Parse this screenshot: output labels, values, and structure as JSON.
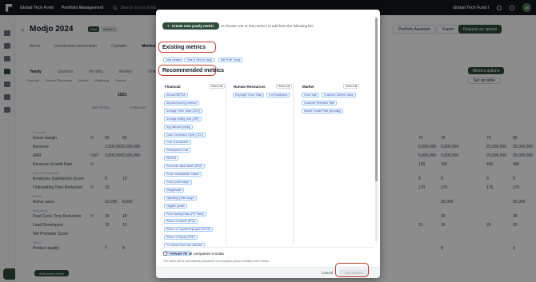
{
  "topbar": {
    "org": "Global Tech Fund",
    "section": "Portfolio Management",
    "search_placeholder": "Search across Edda",
    "fund_selector": "Global Tech Fund I",
    "avatar": "JE"
  },
  "page": {
    "title": "Modjo 2024",
    "status": "Paid",
    "tag": "Series A",
    "tabs": [
      "About",
      "Investments information",
      "Captable",
      "Metrics"
    ],
    "active_tab": "Metrics",
    "buttons": {
      "assistant": "Portfolio Assistant",
      "export": "Export",
      "request": "Request an update"
    },
    "periods": [
      "Yearly",
      "Quarters",
      "Monthly",
      "Weekly",
      "One-off"
    ],
    "active_period": "Yearly",
    "filters": [
      "Financial",
      "Human Resources",
      "Market",
      "Marketing",
      "Product"
    ],
    "metrics_actions": "Metrics actions",
    "set_up_table": "Set up table",
    "col_reported": "REPORTED",
    "col_forecast": "FORECAST",
    "year": "2025",
    "add_yearly_metric": "Add yearly metric",
    "rows": [
      {
        "label": "Financial",
        "section": true
      },
      {
        "label": "Gross margin",
        "unit": "%",
        "v1": "60",
        "v2": "60",
        "v3": "",
        "r1": "74",
        "r2": "75",
        "r3": "79",
        "r4": "80"
      },
      {
        "label": "Revenue",
        "unit": "",
        "v1": "2,500,000",
        "v2": "2,500,000",
        "v3": "",
        "r1": "5,000,000",
        "r2": "5,000,000",
        "r3": "25,000,000",
        "r4": "25,000,000"
      },
      {
        "label": "ARR",
        "unit": "GBP",
        "v1": "2,500,000",
        "v2": "2,500,000",
        "v3": "",
        "r1": "5,000,000",
        "r2": "5,000,000",
        "r3": "25,000,000",
        "r4": "25,000,000"
      },
      {
        "label": "Revenue Growth Rate",
        "unit": "%",
        "v1": "",
        "v2": "",
        "v3": "",
        "r1": "100",
        "r2": "100",
        "r3": "400",
        "r4": "400"
      },
      {
        "label": "Human Resources",
        "section": true
      },
      {
        "label": "Employee Satisfaction Score",
        "unit": "",
        "v1": "8",
        "v2": "10",
        "v3": "",
        "r1": "8",
        "r2": "8",
        "r3": "9",
        "r4": "9"
      },
      {
        "label": "Onboarding Time Reduction",
        "unit": "%",
        "v1": "15",
        "v2": "",
        "v3": "",
        "r1": "170",
        "r2": "175",
        "r3": "175",
        "r4": "175"
      },
      {
        "label": "Market",
        "section": true
      },
      {
        "label": "Active users",
        "unit": "",
        "v1": "10,200",
        "v2": "8,000",
        "v3": "",
        "r1": "",
        "r2": "25,000",
        "r3": "",
        "r4": "50,000"
      },
      {
        "label": "Marketing",
        "section": true
      },
      {
        "label": "Deal Cycle Time Reduction",
        "unit": "%",
        "v1": "15",
        "v2": "18",
        "v3": "",
        "r1": "",
        "r2": "20",
        "r3": "",
        "r4": "25"
      },
      {
        "label": "Lead Developers",
        "unit": "",
        "v1": "10",
        "v2": "10",
        "v3": "",
        "r1": "15",
        "r2": "16",
        "r3": "20",
        "r4": "20"
      },
      {
        "label": "Net Promoter Score",
        "unit": "",
        "v1": "",
        "v2": "",
        "v3": "",
        "r1": "",
        "r2": "",
        "r3": "",
        "r4": ""
      },
      {
        "label": "Other",
        "section": true
      },
      {
        "label": "Product quality",
        "unit": "",
        "v1": "7",
        "v2": "8",
        "v3": "",
        "r1": "",
        "r2": "8",
        "r3": "",
        "r4": "9"
      }
    ]
  },
  "modal": {
    "create_button": "Create new yearly metric",
    "or_choose": "or choose one or few metrics to add from the following list:",
    "existing_title": "Existing metrics",
    "existing": [
      "Jobs created",
      "Time to Hire (in days)",
      "Net Profit Yearly"
    ],
    "recommended_title": "Recommended metrics",
    "select_all": "Select all",
    "columns": {
      "financial": {
        "title": "Financial",
        "items": [
          "Annual EBITDA",
          "Annual recurring revenue",
          "Average Order Value (AOV)",
          "Average selling price (ASP)",
          "Avg discount pricing",
          "Cash Conversion Cycle (CCC)",
          "Cost of production",
          "Development cost",
          "EBITDA",
          "Economic Value Added (EVA)",
          "Gross merchandise volume",
          "Gross profit margin",
          "Margin/sales",
          "Operating profit margin",
          "Organic growth",
          "Price Earning Ratio (P/E Ratio)",
          "Return on Assets (ROA)",
          "Return on Capital Employed (ROCE)",
          "Return on Equity (ROE)",
          "% revenue from new activities",
          "Revenue per user"
        ]
      },
      "hr": {
        "title": "Human Resources",
        "items": [
          "Employee Churn Rate",
          "# of Employees"
        ]
      },
      "market": {
        "title": "Market",
        "items": [
          "Churn rate",
          "Customer Lifetime Value",
          "Customer Retention Rate",
          "Market Growth Rate (annually)"
        ]
      }
    },
    "activate_label": "Activate for all companies in Edda",
    "activate_note": "The metric will be automatically activated in all companies across Dealflow and Portfolio.",
    "cancel": "Cancel",
    "add_metrics": "Add metrics"
  },
  "colors": {
    "brand": "#2e4d3a",
    "highlight": "#c0392b",
    "chip_border": "#93c5fd",
    "chip_text": "#1e40af"
  }
}
